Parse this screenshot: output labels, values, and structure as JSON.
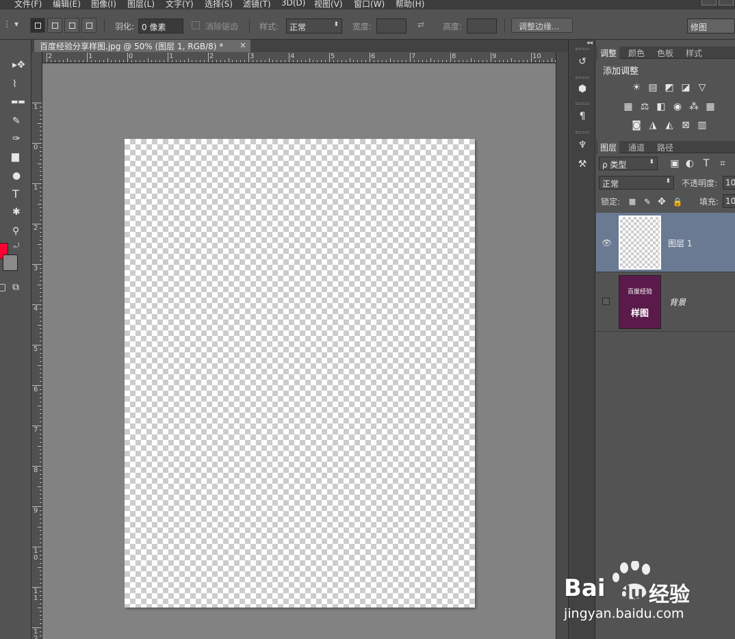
{
  "menubar": {
    "items": [
      "文件(F)",
      "编辑(E)",
      "图像(I)",
      "图层(L)",
      "文字(Y)",
      "选择(S)",
      "滤镜(T)",
      "3D(D)",
      "视图(V)",
      "窗口(W)",
      "帮助(H)"
    ]
  },
  "options": {
    "feather_label": "羽化:",
    "feather_value": "0 像素",
    "antialias_label": "消除锯齿",
    "style_label": "样式:",
    "style_value": "正常",
    "width_label": "宽度:",
    "height_label": "高度:",
    "refine_edge_button": "调整边缘...",
    "workspace_value": "修图"
  },
  "document": {
    "tab_title": "百度经验分享样图.jpg @ 50% (图层 1, RGB/8) *",
    "close_glyph": "×",
    "ruler_top_labels": [
      "2",
      "1",
      "0",
      "1",
      "2",
      "3",
      "4",
      "5",
      "6",
      "7",
      "8",
      "9",
      "10"
    ],
    "ruler_left_labels": [
      "1",
      "0",
      "1",
      "2",
      "3",
      "4",
      "5",
      "6",
      "7",
      "8",
      "9",
      "10",
      "11",
      "12"
    ]
  },
  "colors": {
    "foreground": "#ff0033",
    "background": "#8a8a8a",
    "selected_layer": "#6a7a92",
    "background_layer_thumb": "#5a1a4a"
  },
  "panel_adjust": {
    "tabs": [
      "调整",
      "颜色",
      "色板",
      "样式"
    ],
    "add_adjustment": "添加调整",
    "icons_row1": [
      "brightness-icon",
      "levels-icon",
      "curves-icon",
      "exposure-icon",
      "vibrance-icon"
    ],
    "icons_row2": [
      "hue-icon",
      "color-balance-icon",
      "black-white-icon",
      "photo-filter-icon",
      "channel-mixer-icon",
      "color-lookup-icon"
    ],
    "icons_row3": [
      "invert-icon",
      "posterize-icon",
      "threshold-icon",
      "selective-color-icon",
      "gradient-map-icon"
    ]
  },
  "panel_layers": {
    "tabs": [
      "图层",
      "通道",
      "路径"
    ],
    "filter_value": "ρ 类型",
    "blend_mode": "正常",
    "opacity_label": "不透明度:",
    "opacity_value": "10",
    "lock_label": "锁定:",
    "fill_label": "填充:",
    "fill_value": "10",
    "layers": [
      {
        "name": "图层 1",
        "visible": true,
        "selected": true
      },
      {
        "name": "背景",
        "visible": false,
        "selected": false,
        "thumb_line1": "百度经验",
        "thumb_line2": "样图"
      }
    ]
  },
  "watermark": {
    "brand_bai": "Bai",
    "brand_du": "du",
    "brand_cn": "经验",
    "url": "jingyan.baidu.com"
  }
}
